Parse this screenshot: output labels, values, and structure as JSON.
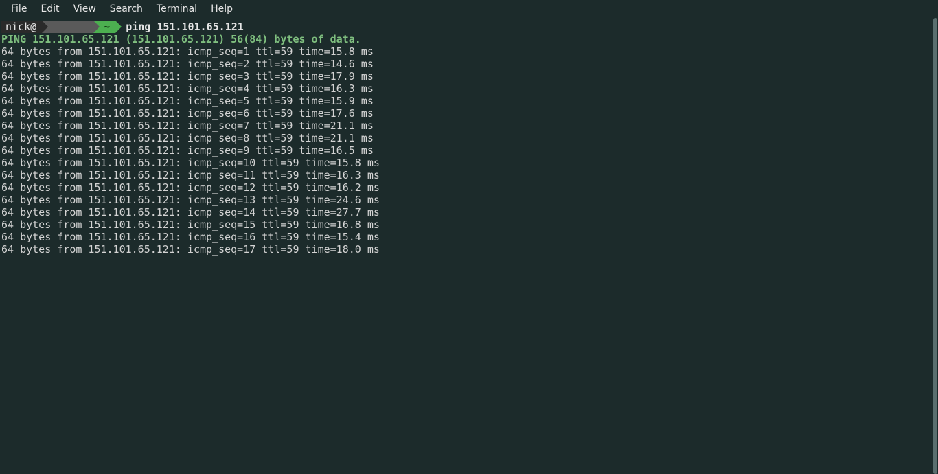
{
  "menubar": {
    "items": [
      "File",
      "Edit",
      "View",
      "Search",
      "Terminal",
      "Help"
    ]
  },
  "prompt": {
    "user": "nick@",
    "host_hidden": "      ",
    "dir": "~",
    "command": "ping 151.101.65.121"
  },
  "ping": {
    "header": "PING 151.101.65.121 (151.101.65.121) 56(84) bytes of data.",
    "bytes": 64,
    "ip": "151.101.65.121",
    "ttl": 59,
    "replies": [
      {
        "seq": 1,
        "time": "15.8"
      },
      {
        "seq": 2,
        "time": "14.6"
      },
      {
        "seq": 3,
        "time": "17.9"
      },
      {
        "seq": 4,
        "time": "16.3"
      },
      {
        "seq": 5,
        "time": "15.9"
      },
      {
        "seq": 6,
        "time": "17.6"
      },
      {
        "seq": 7,
        "time": "21.1"
      },
      {
        "seq": 8,
        "time": "21.1"
      },
      {
        "seq": 9,
        "time": "16.5"
      },
      {
        "seq": 10,
        "time": "15.8"
      },
      {
        "seq": 11,
        "time": "16.3"
      },
      {
        "seq": 12,
        "time": "16.2"
      },
      {
        "seq": 13,
        "time": "24.6"
      },
      {
        "seq": 14,
        "time": "27.7"
      },
      {
        "seq": 15,
        "time": "16.8"
      },
      {
        "seq": 16,
        "time": "15.4"
      },
      {
        "seq": 17,
        "time": "18.0"
      }
    ]
  }
}
